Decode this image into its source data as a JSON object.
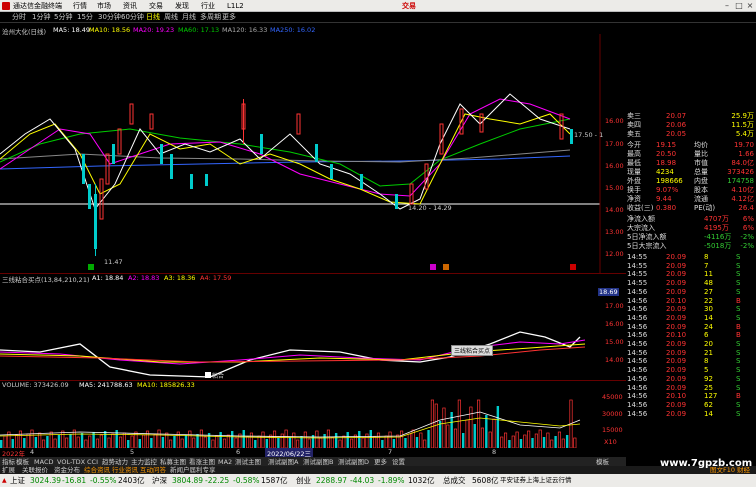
{
  "menubar": {
    "app_title": "通达信金融终端",
    "items": [
      "行情",
      "市场",
      "资讯",
      "交易",
      "发现",
      "行业",
      "L1L2"
    ],
    "trade_label": "交易"
  },
  "periodbar": {
    "items": [
      "分时",
      "1分钟",
      "5分钟",
      "15分",
      "30分钟",
      "60分钟",
      "日线",
      "周线",
      "月线",
      "多周期",
      "更多"
    ],
    "selected": "日线"
  },
  "main_legend": {
    "stock": "沧州大化(日线)",
    "ma5": "MA5: 18.49",
    "ma10": "MA10: 18.56",
    "ma20": "MA20: 19.23",
    "ma60": "MA60: 17.13",
    "ma120": "MA120: 16.33",
    "ma250": "MA250: 16.02"
  },
  "main_annotations": {
    "low_price": "11.47",
    "range_mid": "14.20 - 14.29",
    "range_high": "17.50 - 1"
  },
  "price_axis": [
    "16.00",
    "17.00",
    "16.00",
    "15.00",
    "14.00",
    "13.00",
    "12.00"
  ],
  "ind1_legend": {
    "name": "三线粘合买点(13,84,210,21)",
    "a1": "A1: 18.84",
    "a2": "A2: 18.83",
    "a3": "A3: 18.36",
    "a4": "A4: 17.59"
  },
  "ind1_axis": [
    "18.69",
    "17.00",
    "16.00",
    "15.00",
    "14.00"
  ],
  "ind1_label": "粘合",
  "ind1_hint": "三线粘合买点",
  "vol_legend": {
    "name": "VOLUME: 373426.09",
    "ma5": "MA5: 241788.63",
    "ma10": "MA10: 185826.33"
  },
  "vol_axis": [
    "45000",
    "30000",
    "15000",
    "X10"
  ],
  "date_marker": "2022/06/22三",
  "date_ticks": [
    "2022年",
    "4",
    "5",
    "6",
    "7",
    "8"
  ],
  "orderbook": {
    "sells": [
      [
        "卖三",
        "20.07",
        "25.9万"
      ],
      [
        "卖四",
        "20.06",
        "11.5万"
      ],
      [
        "卖五",
        "20.05",
        "5.4万"
      ]
    ],
    "rows": [
      [
        [
          "今开",
          "19.15"
        ],
        [
          "均价",
          "19.70"
        ]
      ],
      [
        [
          "最高",
          "20.50"
        ],
        [
          "量比",
          "1.66"
        ]
      ],
      [
        [
          "最低",
          "18.98"
        ],
        [
          "市值",
          "84.0亿"
        ]
      ],
      [
        [
          "现量",
          "4234"
        ],
        [
          "总量",
          "373426"
        ]
      ],
      [
        [
          "外盘",
          "198666"
        ],
        [
          "内盘",
          "174758"
        ]
      ],
      [
        [
          "换手",
          "9.07%"
        ],
        [
          "股本",
          "4.10亿"
        ]
      ],
      [
        [
          "净资",
          "9.44"
        ],
        [
          "流通",
          "4.12亿"
        ]
      ],
      [
        [
          "收益(三)",
          "0.380"
        ],
        [
          "PE(动)",
          "26.4"
        ]
      ]
    ],
    "flows": [
      [
        "净流入额",
        "4707万",
        "6%"
      ],
      [
        "大宗流入",
        "4195万",
        "6%"
      ],
      [
        "5日净流入额",
        "-4116万",
        "-2%"
      ],
      [
        "5日大宗流入",
        "-5018万",
        "-2%"
      ]
    ]
  },
  "ticks": [
    [
      "14:55",
      "20.09",
      "8",
      "S"
    ],
    [
      "14:55",
      "20.09",
      "7",
      "S"
    ],
    [
      "14:55",
      "20.09",
      "11",
      "S"
    ],
    [
      "14:55",
      "20.09",
      "48",
      "S"
    ],
    [
      "14:56",
      "20.09",
      "27",
      "S"
    ],
    [
      "14:56",
      "20.10",
      "22",
      "B"
    ],
    [
      "14:56",
      "20.09",
      "30",
      "S"
    ],
    [
      "14:56",
      "20.09",
      "14",
      "S"
    ],
    [
      "14:56",
      "20.09",
      "24",
      "B"
    ],
    [
      "14:56",
      "20.10",
      "6",
      "B"
    ],
    [
      "14:56",
      "20.09",
      "20",
      "S"
    ],
    [
      "14:56",
      "20.09",
      "21",
      "S"
    ],
    [
      "14:56",
      "20.09",
      "8",
      "S"
    ],
    [
      "14:56",
      "20.09",
      "5",
      "S"
    ],
    [
      "14:56",
      "20.09",
      "92",
      "S"
    ],
    [
      "14:56",
      "20.09",
      "25",
      "S"
    ],
    [
      "14:56",
      "20.10",
      "127",
      "B"
    ],
    [
      "14:56",
      "20.09",
      "62",
      "S"
    ],
    [
      "14:56",
      "20.09",
      "14",
      "S"
    ]
  ],
  "tick_units": [
    "万",
    "万",
    "万"
  ],
  "tabs": [
    "指标",
    "模板",
    "MACD",
    "VOL-TDX",
    "CCI",
    "趋势动力",
    "主力监控",
    "私募主图",
    "看涨主图",
    "MA2",
    "测试主图",
    "测试副图A",
    "测试副图B",
    "测试副图D",
    "更多",
    "设置"
  ],
  "tabs2": [
    "扩展",
    "关联报价",
    "资金分布",
    "综合资讯",
    "行业资讯",
    "互动问答",
    "新闻户届利专享"
  ],
  "tabs2_right": "图文F10 财经",
  "tabs_right": "模板",
  "watermark": "www.7gpzb.com",
  "statusbar": {
    "sh_label": "上证",
    "sh_val": "3024.39",
    "sh_chg": "-16.81",
    "sh_pct": "-0.55%",
    "sh_amt": "2403亿",
    "hs_label": "沪深",
    "hs_val": "3804.89",
    "hs_chg": "-22.25",
    "hs_pct": "-0.58%",
    "hs_amt": "1587亿",
    "cy_label": "创业",
    "cy_val": "2288.97",
    "cy_chg": "-44.03",
    "cy_pct": "-1.89%",
    "cy_amt": "1032亿",
    "tot_label": "总成交",
    "tot_amt": "5608亿",
    "news": "平安证券上海上证云行情"
  },
  "colors": {
    "up": "#ff3333",
    "down": "#00ffff",
    "ma5": "#ffffff",
    "ma10": "#ffff00",
    "ma20": "#ff00ff",
    "ma60": "#00cc00",
    "ma120": "#aaaaaa",
    "ma250": "#3366ff"
  }
}
